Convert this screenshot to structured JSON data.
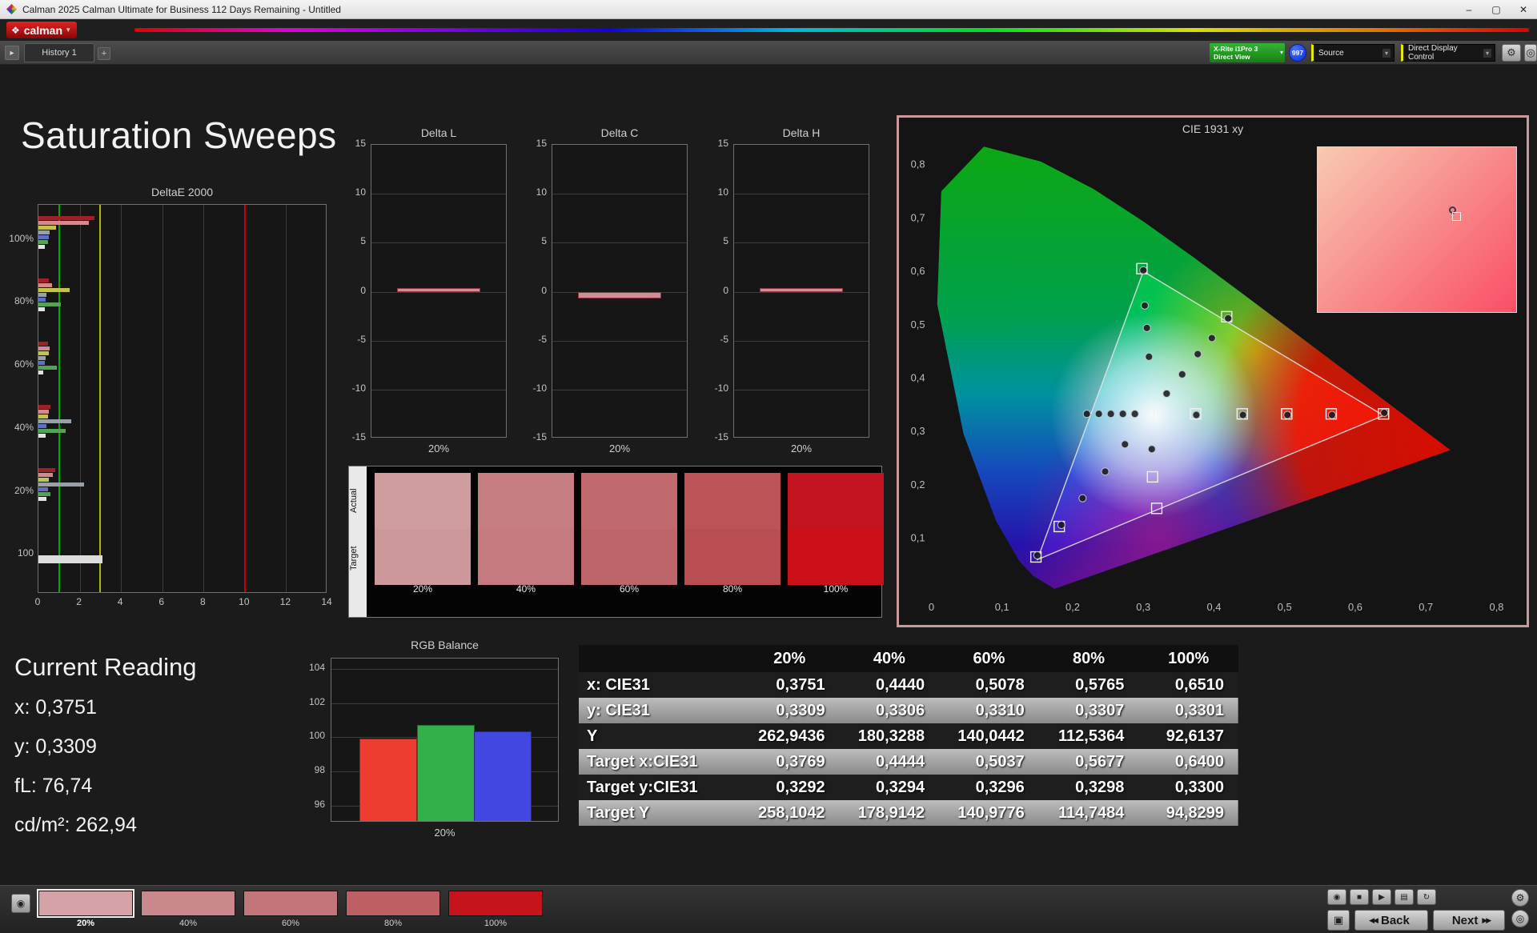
{
  "window": {
    "title": "Calman 2025 Calman Ultimate for Business 112 Days Remaining  - Untitled",
    "controls": {
      "minimize": "–",
      "maximize": "▢",
      "close": "✕"
    }
  },
  "brand": {
    "logo": "calman"
  },
  "tabbar": {
    "history_tab": "History 1",
    "meter": {
      "line1": "X-Rite i1Pro 3",
      "line2": "Direct View"
    },
    "badge": "997",
    "source": "Source",
    "display_control": "Direct Display Control"
  },
  "page_title": "Saturation Sweeps",
  "current_reading": {
    "heading": "Current Reading",
    "lines": [
      "x: 0,3751",
      "y: 0,3309",
      "fL: 76,74",
      "cd/m²: 262,94"
    ]
  },
  "swatch_panel": {
    "row_labels": [
      "Actual",
      "Target"
    ],
    "columns": [
      {
        "label": "20%",
        "actual": "#cf9ca0",
        "target": "#cc989c"
      },
      {
        "label": "40%",
        "actual": "#c67e82",
        "target": "#c47a7e"
      },
      {
        "label": "60%",
        "actual": "#c06a6e",
        "target": "#be6569"
      },
      {
        "label": "80%",
        "actual": "#bb5357",
        "target": "#b94e52"
      },
      {
        "label": "100%",
        "actual": "#c41420",
        "target": "#cb1018"
      }
    ]
  },
  "table": {
    "headers": [
      "20%",
      "40%",
      "60%",
      "80%",
      "100%"
    ],
    "rows": [
      {
        "label": "x: CIE31",
        "values": [
          "0,3751",
          "0,4440",
          "0,5078",
          "0,5765",
          "0,6510"
        ]
      },
      {
        "label": "y: CIE31",
        "values": [
          "0,3309",
          "0,3306",
          "0,3310",
          "0,3307",
          "0,3301"
        ]
      },
      {
        "label": "Y",
        "values": [
          "262,9436",
          "180,3288",
          "140,0442",
          "112,5364",
          "92,6137"
        ]
      },
      {
        "label": "Target x:CIE31",
        "values": [
          "0,3769",
          "0,4444",
          "0,5037",
          "0,5677",
          "0,6400"
        ]
      },
      {
        "label": "Target y:CIE31",
        "values": [
          "0,3292",
          "0,3294",
          "0,3296",
          "0,3298",
          "0,3300"
        ]
      },
      {
        "label": "Target Y",
        "values": [
          "258,1042",
          "178,9142",
          "140,9776",
          "114,7484",
          "94,8299"
        ]
      }
    ]
  },
  "bottom": {
    "swatches": [
      {
        "label": "20%",
        "color": "#d5a3a7",
        "selected": true
      },
      {
        "label": "40%",
        "color": "#c8888c",
        "selected": false
      },
      {
        "label": "60%",
        "color": "#c2767a",
        "selected": false
      },
      {
        "label": "80%",
        "color": "#bd5f63",
        "selected": false
      },
      {
        "label": "100%",
        "color": "#c6141c",
        "selected": false
      }
    ],
    "transport": [
      {
        "name": "meter-icon",
        "glyph": "◉"
      },
      {
        "name": "stop-icon",
        "glyph": "■"
      },
      {
        "name": "play-icon",
        "glyph": "▶"
      },
      {
        "name": "film-icon",
        "glyph": "▤"
      },
      {
        "name": "loop-icon",
        "glyph": "↻"
      }
    ],
    "side_buttons": [
      {
        "name": "gear-icon",
        "glyph": "⚙"
      },
      {
        "name": "power-icon",
        "glyph": "◎"
      }
    ],
    "stop_glyph": "▣",
    "back": "Back",
    "next": "Next"
  },
  "chart_data": [
    {
      "id": "deltae2000",
      "type": "bar",
      "orientation": "horizontal",
      "title": "DeltaE 2000",
      "xlim": [
        0,
        14
      ],
      "xticks": [
        0,
        2,
        4,
        6,
        8,
        10,
        12,
        14
      ],
      "reference_lines": [
        {
          "value": 1,
          "color": "#00a800"
        },
        {
          "value": 3,
          "color": "#b4b400"
        },
        {
          "value": 10,
          "color": "#c80000"
        }
      ],
      "groups": [
        {
          "label": "100%",
          "bars": [
            {
              "value": 2.7,
              "color": "#9e2028"
            },
            {
              "value": 2.45,
              "color": "#d4898f"
            },
            {
              "value": 0.85,
              "color": "#c2c24e"
            },
            {
              "value": 0.55,
              "color": "#9aa0a8"
            },
            {
              "value": 0.5,
              "color": "#5f6fc8"
            },
            {
              "value": 0.45,
              "color": "#54a254"
            },
            {
              "value": 0.3,
              "color": "#e2e2e2"
            }
          ]
        },
        {
          "label": "80%",
          "bars": [
            {
              "value": 0.5,
              "color": "#9e2028"
            },
            {
              "value": 0.65,
              "color": "#d4898f"
            },
            {
              "value": 1.5,
              "color": "#c2c24e"
            },
            {
              "value": 0.4,
              "color": "#9aa0a8"
            },
            {
              "value": 0.35,
              "color": "#5f6fc8"
            },
            {
              "value": 1.1,
              "color": "#54a254"
            },
            {
              "value": 0.3,
              "color": "#e2e2e2"
            }
          ]
        },
        {
          "label": "60%",
          "bars": [
            {
              "value": 0.45,
              "color": "#9e2028"
            },
            {
              "value": 0.55,
              "color": "#d4898f"
            },
            {
              "value": 0.5,
              "color": "#c2c24e"
            },
            {
              "value": 0.35,
              "color": "#9aa0a8"
            },
            {
              "value": 0.3,
              "color": "#5f6fc8"
            },
            {
              "value": 0.9,
              "color": "#54a254"
            },
            {
              "value": 0.25,
              "color": "#e2e2e2"
            }
          ]
        },
        {
          "label": "40%",
          "bars": [
            {
              "value": 0.6,
              "color": "#9e2028"
            },
            {
              "value": 0.5,
              "color": "#d4898f"
            },
            {
              "value": 0.45,
              "color": "#c2c24e"
            },
            {
              "value": 1.6,
              "color": "#9aa0a8"
            },
            {
              "value": 0.4,
              "color": "#5f6fc8"
            },
            {
              "value": 1.3,
              "color": "#54a254"
            },
            {
              "value": 0.35,
              "color": "#e2e2e2"
            }
          ]
        },
        {
          "label": "20%",
          "bars": [
            {
              "value": 0.8,
              "color": "#9e2028"
            },
            {
              "value": 0.7,
              "color": "#d4898f"
            },
            {
              "value": 0.5,
              "color": "#c2c24e"
            },
            {
              "value": 2.2,
              "color": "#9aa0a8"
            },
            {
              "value": 0.45,
              "color": "#5f6fc8"
            },
            {
              "value": 0.6,
              "color": "#54a254"
            },
            {
              "value": 0.4,
              "color": "#e2e2e2"
            }
          ]
        },
        {
          "label": "100",
          "bars": [
            {
              "value": 3.1,
              "color": "#dcdcdc",
              "thick": true
            }
          ]
        }
      ]
    },
    {
      "id": "deltaL",
      "type": "bar",
      "title": "Delta L",
      "categories": [
        "20%"
      ],
      "values": [
        0.4
      ],
      "ylim": [
        -15,
        15
      ],
      "yticks": [
        15,
        10,
        5,
        0,
        -5,
        -10,
        -15
      ],
      "bar_color": "#cf8d95",
      "bar_border": "#8a3640"
    },
    {
      "id": "deltaC",
      "type": "bar",
      "title": "Delta C",
      "categories": [
        "20%"
      ],
      "values": [
        -0.7
      ],
      "ylim": [
        -15,
        15
      ],
      "yticks": [
        15,
        10,
        5,
        0,
        -5,
        -10,
        -15
      ],
      "bar_color": "#cf8d95",
      "bar_border": "#8a3640"
    },
    {
      "id": "deltaH",
      "type": "bar",
      "title": "Delta H",
      "categories": [
        "20%"
      ],
      "values": [
        0.35
      ],
      "ylim": [
        -15,
        15
      ],
      "yticks": [
        15,
        10,
        5,
        0,
        -5,
        -10,
        -15
      ],
      "bar_color": "#cf8d95",
      "bar_border": "#8a3640"
    },
    {
      "id": "rgb_balance",
      "type": "bar",
      "title": "RGB Balance",
      "categories": [
        "20%"
      ],
      "series": [
        {
          "name": "Red",
          "value": 99.9,
          "color": "#ee3c30"
        },
        {
          "name": "Green",
          "value": 100.7,
          "color": "#34b04a"
        },
        {
          "name": "Blue",
          "value": 100.35,
          "color": "#4347e2"
        }
      ],
      "ylim": [
        95,
        104.6
      ],
      "yticks": [
        104,
        102,
        100,
        98,
        96
      ]
    },
    {
      "id": "cie",
      "type": "scatter",
      "title": "CIE 1931 xy",
      "xlim": [
        0,
        0.8
      ],
      "ylim": [
        0,
        0.85
      ],
      "xtick_labels": [
        "0",
        "0,1",
        "0,2",
        "0,3",
        "0,4",
        "0,5",
        "0,6",
        "0,7",
        "0,8"
      ],
      "ytick_labels": [
        "0,1",
        "0,2",
        "0,3",
        "0,4",
        "0,5",
        "0,6",
        "0,7",
        "0,8"
      ],
      "gamut_triangle": [
        [
          0.64,
          0.33
        ],
        [
          0.3,
          0.6
        ],
        [
          0.15,
          0.06
        ]
      ],
      "target_squares": [
        [
          0.298,
          0.605
        ],
        [
          0.418,
          0.515
        ],
        [
          0.308,
          0.333
        ],
        [
          0.374,
          0.333
        ],
        [
          0.44,
          0.333
        ],
        [
          0.503,
          0.333
        ],
        [
          0.566,
          0.333
        ],
        [
          0.64,
          0.333
        ],
        [
          0.313,
          0.215
        ],
        [
          0.319,
          0.156
        ],
        [
          0.181,
          0.122
        ],
        [
          0.148,
          0.065
        ]
      ],
      "measured_points": [
        [
          0.3,
          0.602
        ],
        [
          0.302,
          0.536
        ],
        [
          0.305,
          0.494
        ],
        [
          0.308,
          0.44
        ],
        [
          0.42,
          0.512
        ],
        [
          0.397,
          0.475
        ],
        [
          0.377,
          0.445
        ],
        [
          0.355,
          0.407
        ],
        [
          0.333,
          0.371
        ],
        [
          0.22,
          0.333
        ],
        [
          0.237,
          0.333
        ],
        [
          0.254,
          0.333
        ],
        [
          0.271,
          0.333
        ],
        [
          0.288,
          0.333
        ],
        [
          0.375,
          0.331
        ],
        [
          0.441,
          0.331
        ],
        [
          0.504,
          0.331
        ],
        [
          0.567,
          0.331
        ],
        [
          0.641,
          0.335
        ],
        [
          0.274,
          0.276
        ],
        [
          0.246,
          0.225
        ],
        [
          0.214,
          0.175
        ],
        [
          0.312,
          0.267
        ],
        [
          0.184,
          0.125
        ],
        [
          0.15,
          0.068
        ]
      ],
      "inset": {
        "gradient_from": "#f7cab3",
        "gradient_to": "#fa4e66",
        "marker": {
          "x_pct": 66,
          "y_pct": 36
        }
      }
    }
  ]
}
